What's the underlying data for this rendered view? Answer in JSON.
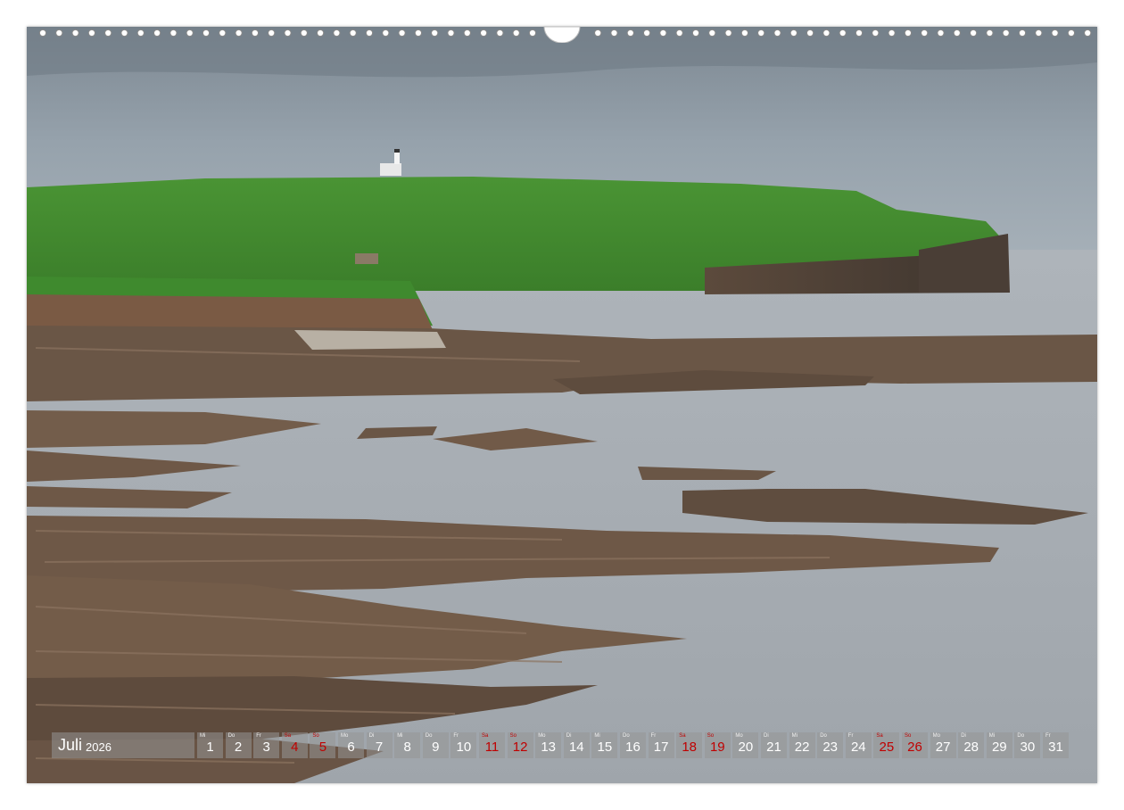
{
  "calendar": {
    "month": "Juli",
    "year": "2026",
    "days": [
      {
        "wd": "Mi",
        "n": "1",
        "we": false
      },
      {
        "wd": "Do",
        "n": "2",
        "we": false
      },
      {
        "wd": "Fr",
        "n": "3",
        "we": false
      },
      {
        "wd": "Sa",
        "n": "4",
        "we": true
      },
      {
        "wd": "So",
        "n": "5",
        "we": true
      },
      {
        "wd": "Mo",
        "n": "6",
        "we": false
      },
      {
        "wd": "Di",
        "n": "7",
        "we": false
      },
      {
        "wd": "Mi",
        "n": "8",
        "we": false
      },
      {
        "wd": "Do",
        "n": "9",
        "we": false
      },
      {
        "wd": "Fr",
        "n": "10",
        "we": false
      },
      {
        "wd": "Sa",
        "n": "11",
        "we": true
      },
      {
        "wd": "So",
        "n": "12",
        "we": true
      },
      {
        "wd": "Mo",
        "n": "13",
        "we": false
      },
      {
        "wd": "Di",
        "n": "14",
        "we": false
      },
      {
        "wd": "Mi",
        "n": "15",
        "we": false
      },
      {
        "wd": "Do",
        "n": "16",
        "we": false
      },
      {
        "wd": "Fr",
        "n": "17",
        "we": false
      },
      {
        "wd": "Sa",
        "n": "18",
        "we": true
      },
      {
        "wd": "So",
        "n": "19",
        "we": true
      },
      {
        "wd": "Mo",
        "n": "20",
        "we": false
      },
      {
        "wd": "Di",
        "n": "21",
        "we": false
      },
      {
        "wd": "Mi",
        "n": "22",
        "we": false
      },
      {
        "wd": "Do",
        "n": "23",
        "we": false
      },
      {
        "wd": "Fr",
        "n": "24",
        "we": false
      },
      {
        "wd": "Sa",
        "n": "25",
        "we": true
      },
      {
        "wd": "So",
        "n": "26",
        "we": true
      },
      {
        "wd": "Mo",
        "n": "27",
        "we": false
      },
      {
        "wd": "Di",
        "n": "28",
        "we": false
      },
      {
        "wd": "Mi",
        "n": "29",
        "we": false
      },
      {
        "wd": "Do",
        "n": "30",
        "we": false
      },
      {
        "wd": "Fr",
        "n": "31",
        "we": false
      }
    ]
  },
  "colors": {
    "sky": "#8e9ba6",
    "grass": "#3f8a2e",
    "water": "#a7adb3",
    "rock": "#6e5847",
    "weekend": "#c00000",
    "strip": "#969696"
  }
}
